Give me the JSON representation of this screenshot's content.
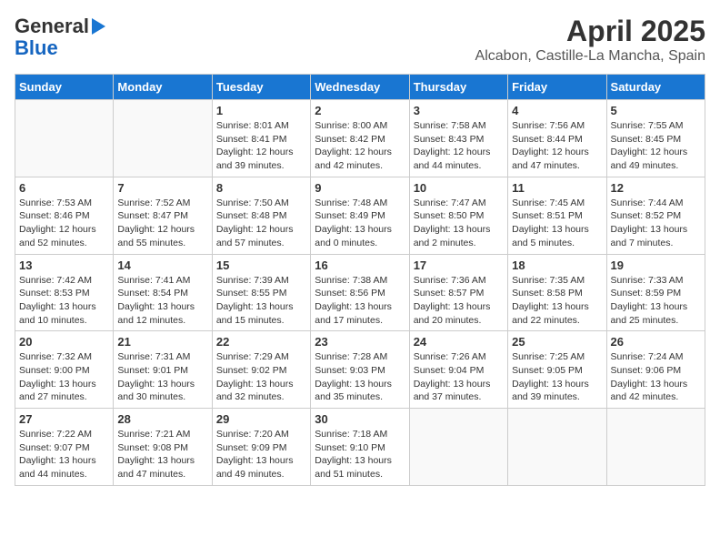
{
  "header": {
    "logo_general": "General",
    "logo_blue": "Blue",
    "title": "April 2025",
    "subtitle": "Alcabon, Castille-La Mancha, Spain"
  },
  "days_of_week": [
    "Sunday",
    "Monday",
    "Tuesday",
    "Wednesday",
    "Thursday",
    "Friday",
    "Saturday"
  ],
  "weeks": [
    [
      {
        "day": "",
        "info": ""
      },
      {
        "day": "",
        "info": ""
      },
      {
        "day": "1",
        "info": "Sunrise: 8:01 AM\nSunset: 8:41 PM\nDaylight: 12 hours and 39 minutes."
      },
      {
        "day": "2",
        "info": "Sunrise: 8:00 AM\nSunset: 8:42 PM\nDaylight: 12 hours and 42 minutes."
      },
      {
        "day": "3",
        "info": "Sunrise: 7:58 AM\nSunset: 8:43 PM\nDaylight: 12 hours and 44 minutes."
      },
      {
        "day": "4",
        "info": "Sunrise: 7:56 AM\nSunset: 8:44 PM\nDaylight: 12 hours and 47 minutes."
      },
      {
        "day": "5",
        "info": "Sunrise: 7:55 AM\nSunset: 8:45 PM\nDaylight: 12 hours and 49 minutes."
      }
    ],
    [
      {
        "day": "6",
        "info": "Sunrise: 7:53 AM\nSunset: 8:46 PM\nDaylight: 12 hours and 52 minutes."
      },
      {
        "day": "7",
        "info": "Sunrise: 7:52 AM\nSunset: 8:47 PM\nDaylight: 12 hours and 55 minutes."
      },
      {
        "day": "8",
        "info": "Sunrise: 7:50 AM\nSunset: 8:48 PM\nDaylight: 12 hours and 57 minutes."
      },
      {
        "day": "9",
        "info": "Sunrise: 7:48 AM\nSunset: 8:49 PM\nDaylight: 13 hours and 0 minutes."
      },
      {
        "day": "10",
        "info": "Sunrise: 7:47 AM\nSunset: 8:50 PM\nDaylight: 13 hours and 2 minutes."
      },
      {
        "day": "11",
        "info": "Sunrise: 7:45 AM\nSunset: 8:51 PM\nDaylight: 13 hours and 5 minutes."
      },
      {
        "day": "12",
        "info": "Sunrise: 7:44 AM\nSunset: 8:52 PM\nDaylight: 13 hours and 7 minutes."
      }
    ],
    [
      {
        "day": "13",
        "info": "Sunrise: 7:42 AM\nSunset: 8:53 PM\nDaylight: 13 hours and 10 minutes."
      },
      {
        "day": "14",
        "info": "Sunrise: 7:41 AM\nSunset: 8:54 PM\nDaylight: 13 hours and 12 minutes."
      },
      {
        "day": "15",
        "info": "Sunrise: 7:39 AM\nSunset: 8:55 PM\nDaylight: 13 hours and 15 minutes."
      },
      {
        "day": "16",
        "info": "Sunrise: 7:38 AM\nSunset: 8:56 PM\nDaylight: 13 hours and 17 minutes."
      },
      {
        "day": "17",
        "info": "Sunrise: 7:36 AM\nSunset: 8:57 PM\nDaylight: 13 hours and 20 minutes."
      },
      {
        "day": "18",
        "info": "Sunrise: 7:35 AM\nSunset: 8:58 PM\nDaylight: 13 hours and 22 minutes."
      },
      {
        "day": "19",
        "info": "Sunrise: 7:33 AM\nSunset: 8:59 PM\nDaylight: 13 hours and 25 minutes."
      }
    ],
    [
      {
        "day": "20",
        "info": "Sunrise: 7:32 AM\nSunset: 9:00 PM\nDaylight: 13 hours and 27 minutes."
      },
      {
        "day": "21",
        "info": "Sunrise: 7:31 AM\nSunset: 9:01 PM\nDaylight: 13 hours and 30 minutes."
      },
      {
        "day": "22",
        "info": "Sunrise: 7:29 AM\nSunset: 9:02 PM\nDaylight: 13 hours and 32 minutes."
      },
      {
        "day": "23",
        "info": "Sunrise: 7:28 AM\nSunset: 9:03 PM\nDaylight: 13 hours and 35 minutes."
      },
      {
        "day": "24",
        "info": "Sunrise: 7:26 AM\nSunset: 9:04 PM\nDaylight: 13 hours and 37 minutes."
      },
      {
        "day": "25",
        "info": "Sunrise: 7:25 AM\nSunset: 9:05 PM\nDaylight: 13 hours and 39 minutes."
      },
      {
        "day": "26",
        "info": "Sunrise: 7:24 AM\nSunset: 9:06 PM\nDaylight: 13 hours and 42 minutes."
      }
    ],
    [
      {
        "day": "27",
        "info": "Sunrise: 7:22 AM\nSunset: 9:07 PM\nDaylight: 13 hours and 44 minutes."
      },
      {
        "day": "28",
        "info": "Sunrise: 7:21 AM\nSunset: 9:08 PM\nDaylight: 13 hours and 47 minutes."
      },
      {
        "day": "29",
        "info": "Sunrise: 7:20 AM\nSunset: 9:09 PM\nDaylight: 13 hours and 49 minutes."
      },
      {
        "day": "30",
        "info": "Sunrise: 7:18 AM\nSunset: 9:10 PM\nDaylight: 13 hours and 51 minutes."
      },
      {
        "day": "",
        "info": ""
      },
      {
        "day": "",
        "info": ""
      },
      {
        "day": "",
        "info": ""
      }
    ]
  ]
}
